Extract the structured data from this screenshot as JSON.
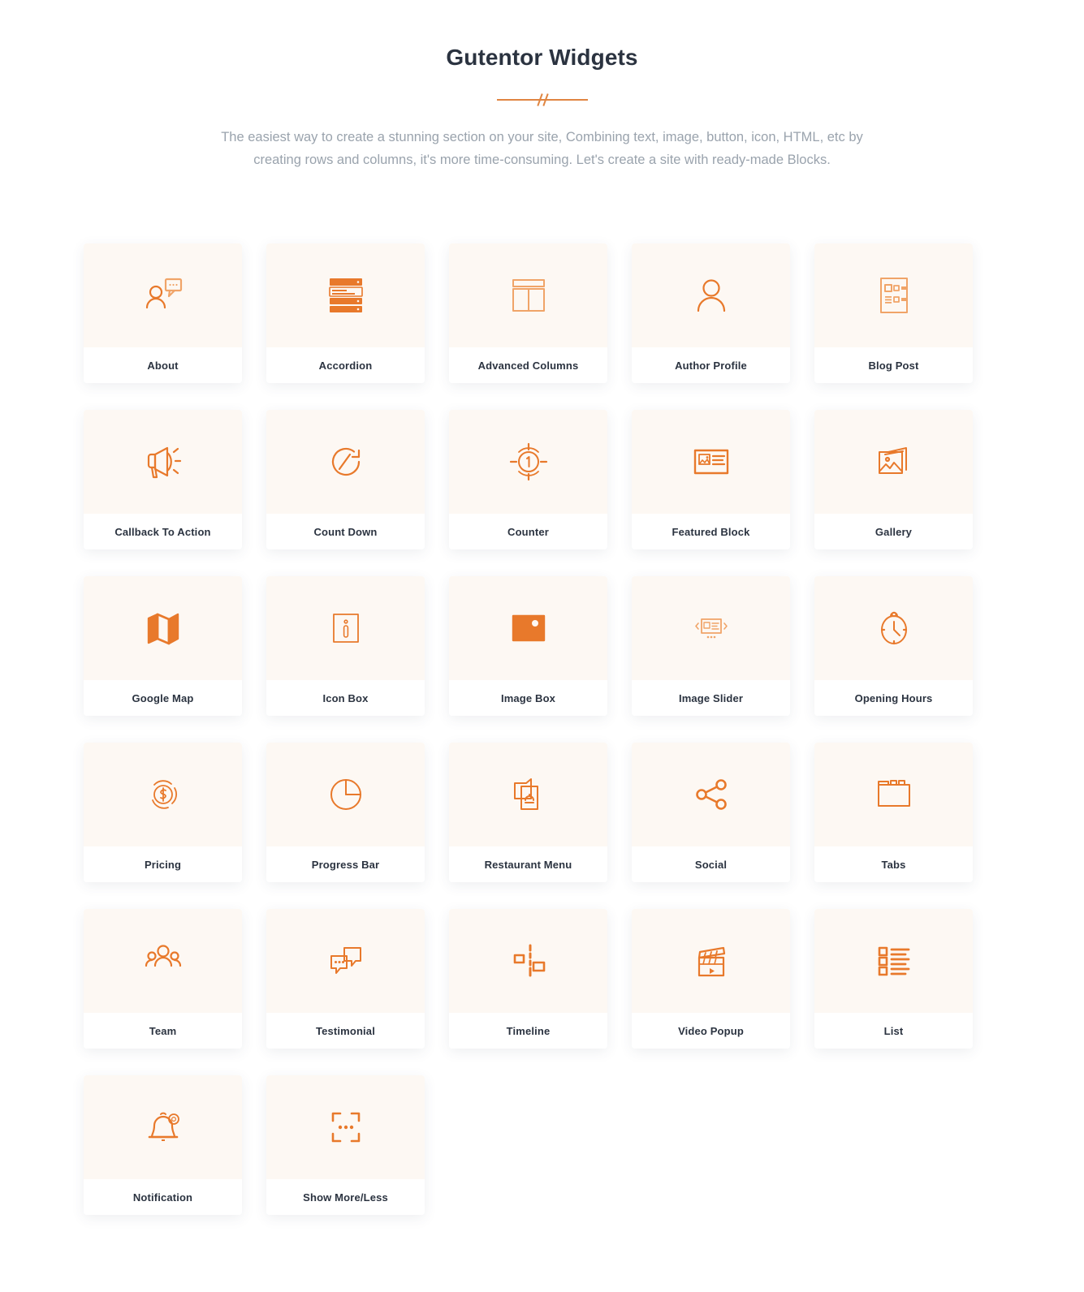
{
  "header": {
    "title": "Gutentor Widgets",
    "subtitle": "The easiest way to create a stunning section on your site, Combining text, image, button, icon, HTML, etc by creating rows and columns, it's more time-consuming. Let's create a site with ready-made Blocks.",
    "divider_icon": "double-slash-divider"
  },
  "colors": {
    "accent": "#e8792b",
    "accent_light": "#f0a468",
    "icon_tile_bg": "#fdf8f3",
    "title": "#2b3340",
    "subtitle": "#9aa3ad",
    "card_bg": "#ffffff",
    "page_bg": "#ffffff"
  },
  "widgets": [
    {
      "label": "About",
      "icon": "person-speech-bubble-icon"
    },
    {
      "label": "Accordion",
      "icon": "accordion-panels-icon"
    },
    {
      "label": "Advanced Columns",
      "icon": "columns-layout-icon"
    },
    {
      "label": "Author Profile",
      "icon": "person-icon"
    },
    {
      "label": "Blog Post",
      "icon": "blog-post-layout-icon"
    },
    {
      "label": "Callback To Action",
      "icon": "megaphone-icon"
    },
    {
      "label": "Count Down",
      "icon": "countdown-clock-icon"
    },
    {
      "label": "Counter",
      "icon": "counter-number-one-icon"
    },
    {
      "label": "Featured Block",
      "icon": "featured-image-text-icon"
    },
    {
      "label": "Gallery",
      "icon": "gallery-photos-icon"
    },
    {
      "label": "Google Map",
      "icon": "folded-map-icon"
    },
    {
      "label": "Icon Box",
      "icon": "info-box-icon"
    },
    {
      "label": "Image Box",
      "icon": "image-filled-icon"
    },
    {
      "label": "Image Slider",
      "icon": "image-slider-icon"
    },
    {
      "label": "Opening Hours",
      "icon": "stopwatch-clock-icon"
    },
    {
      "label": "Pricing",
      "icon": "dollar-coin-icon"
    },
    {
      "label": "Progress Bar",
      "icon": "pie-chart-icon"
    },
    {
      "label": "Restaurant Menu",
      "icon": "restaurant-menu-icon"
    },
    {
      "label": "Social",
      "icon": "share-nodes-icon"
    },
    {
      "label": "Tabs",
      "icon": "tabs-folder-icon"
    },
    {
      "label": "Team",
      "icon": "people-group-icon"
    },
    {
      "label": "Testimonial",
      "icon": "speech-bubbles-icon"
    },
    {
      "label": "Timeline",
      "icon": "timeline-icon"
    },
    {
      "label": "Video Popup",
      "icon": "clapperboard-icon"
    },
    {
      "label": "List",
      "icon": "bullet-list-icon"
    },
    {
      "label": "Notification",
      "icon": "bell-notification-icon"
    },
    {
      "label": "Show More/Less",
      "icon": "expand-dots-icon"
    }
  ]
}
